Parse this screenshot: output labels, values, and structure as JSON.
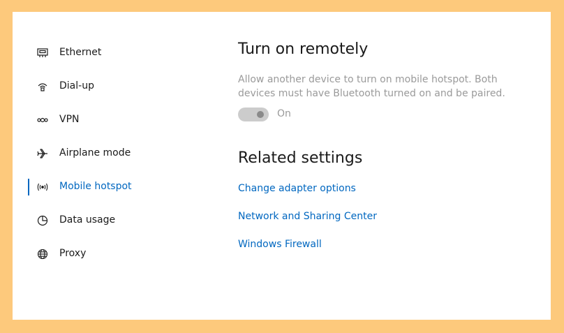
{
  "nav": {
    "items": [
      {
        "label": "Ethernet",
        "icon": "ethernet-icon"
      },
      {
        "label": "Dial-up",
        "icon": "dial-up-icon"
      },
      {
        "label": "VPN",
        "icon": "vpn-icon"
      },
      {
        "label": "Airplane mode",
        "icon": "airplane-icon"
      },
      {
        "label": "Mobile hotspot",
        "icon": "mobile-hotspot-icon",
        "selected": true
      },
      {
        "label": "Data usage",
        "icon": "data-usage-icon"
      },
      {
        "label": "Proxy",
        "icon": "globe-icon"
      }
    ]
  },
  "remote": {
    "heading": "Turn on remotely",
    "description": "Allow another device to turn on mobile hotspot. Both devices must have Bluetooth turned on and be paired.",
    "toggle_label": "On",
    "toggle_on": true,
    "toggle_enabled": false
  },
  "related": {
    "heading": "Related settings",
    "links": [
      "Change adapter options",
      "Network and Sharing Center",
      "Windows Firewall"
    ]
  },
  "colors": {
    "accent": "#0067c0",
    "background": "#fdc97c",
    "disabled_text": "#9a9a9a"
  }
}
